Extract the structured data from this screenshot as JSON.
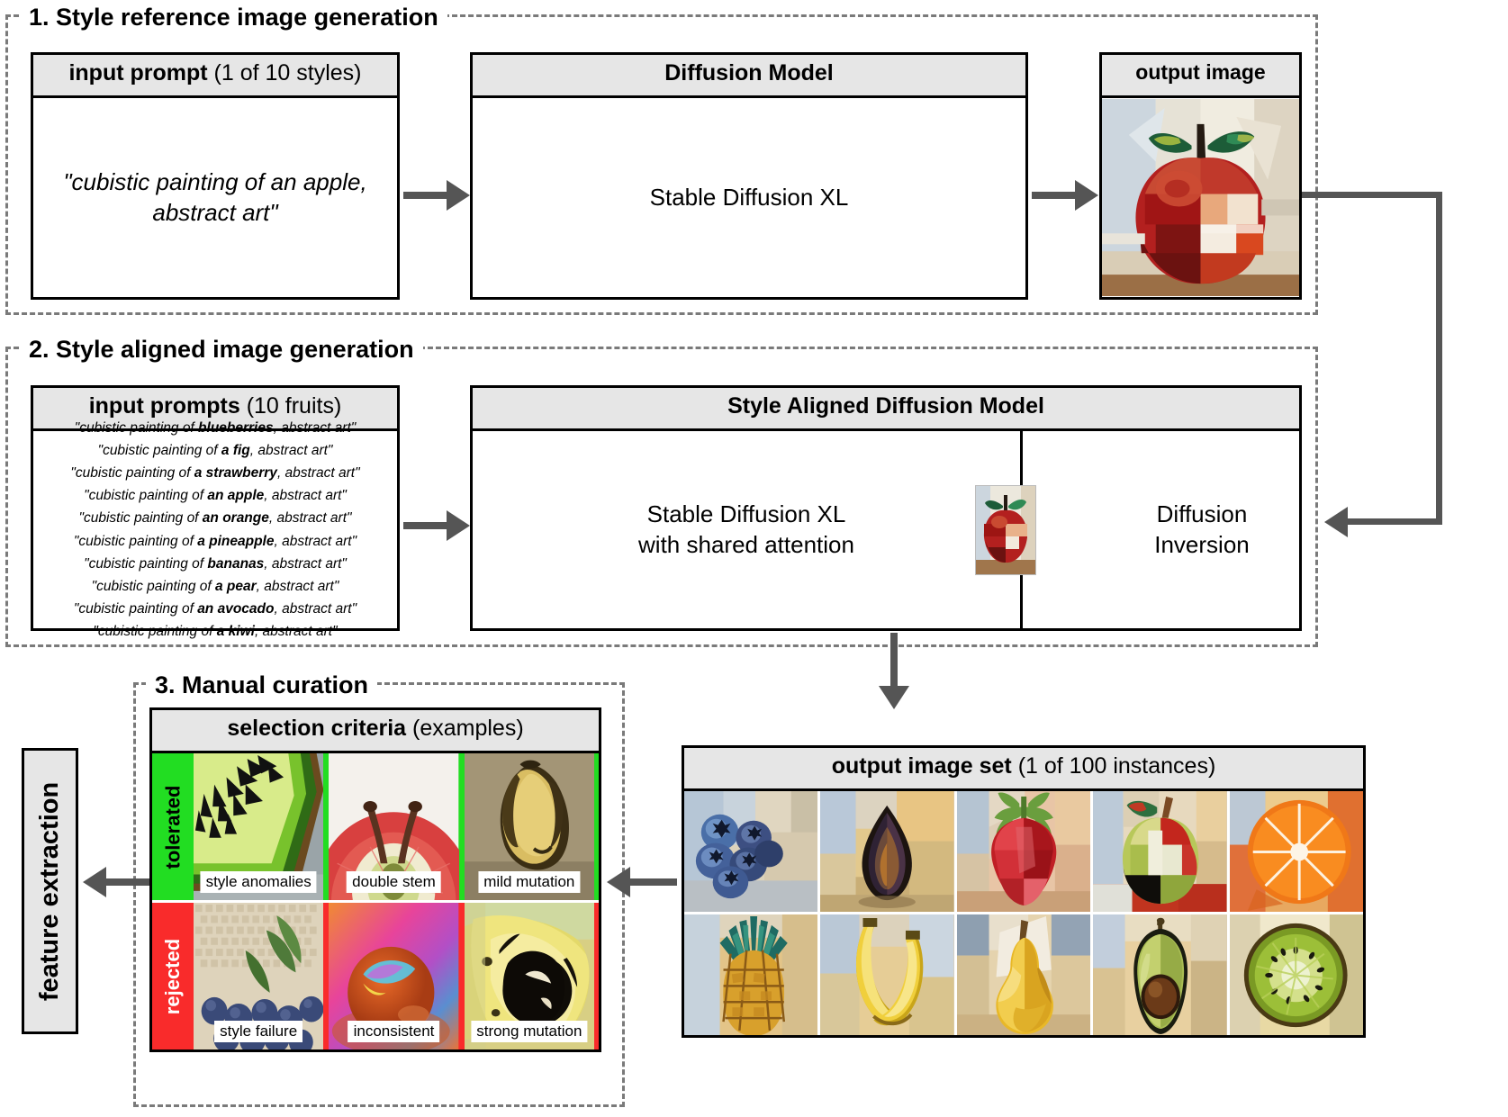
{
  "stages": {
    "stage1": {
      "title": "1. Style reference image generation"
    },
    "stage2": {
      "title": "2. Style aligned image generation"
    },
    "stage3": {
      "title": "3. Manual curation"
    }
  },
  "stage1": {
    "input_box": {
      "header_bold": "input prompt",
      "header_rest": " (1 of 10 styles)",
      "prompt": "\"cubistic painting of an apple, abstract art\""
    },
    "model_box": {
      "header_bold": "Diffusion Model",
      "body": "Stable Diffusion XL"
    },
    "output_box": {
      "header_bold": "output image",
      "image_alt": "cubistic-apple-painting"
    }
  },
  "stage2": {
    "input_box": {
      "header_bold": "input prompts",
      "header_rest": " (10 fruits)",
      "prompts": [
        {
          "prefix": "\"cubistic painting of ",
          "fruit": "blueberries",
          "suffix": ", abstract art\""
        },
        {
          "prefix": "\"cubistic painting of ",
          "fruit": "a fig",
          "suffix": ", abstract art\""
        },
        {
          "prefix": "\"cubistic painting of ",
          "fruit": "a strawberry",
          "suffix": ", abstract art\""
        },
        {
          "prefix": "\"cubistic painting of ",
          "fruit": "an apple",
          "suffix": ", abstract art\""
        },
        {
          "prefix": "\"cubistic painting of ",
          "fruit": "an orange",
          "suffix": ", abstract art\""
        },
        {
          "prefix": "\"cubistic painting of ",
          "fruit": "a pineapple",
          "suffix": ", abstract art\""
        },
        {
          "prefix": "\"cubistic painting of ",
          "fruit": "bananas",
          "suffix": ", abstract art\""
        },
        {
          "prefix": "\"cubistic painting of ",
          "fruit": "a pear",
          "suffix": ", abstract art\""
        },
        {
          "prefix": "\"cubistic painting of ",
          "fruit": "an avocado",
          "suffix": ", abstract art\""
        },
        {
          "prefix": "\"cubistic painting of ",
          "fruit": "a kiwi",
          "suffix": ", abstract art\""
        }
      ]
    },
    "model_box": {
      "header_bold": "Style Aligned Diffusion Model",
      "left_line1": "Stable Diffusion XL",
      "left_line2": "with shared attention",
      "right_line1": "Diffusion",
      "right_line2": "Inversion",
      "thumb_alt": "cubistic-apple-thumbnail"
    }
  },
  "stage3": {
    "criteria_box": {
      "header_bold": "selection criteria",
      "header_rest": " (examples)",
      "tolerated_label": "tolerated",
      "rejected_label": "rejected",
      "tolerated_color": "#22dd22",
      "rejected_color": "#f92b2b",
      "tolerated": [
        {
          "caption": "style anomalies",
          "subject": "kiwi-slice-pixelated"
        },
        {
          "caption": "double stem",
          "subject": "apple-double-stem"
        },
        {
          "caption": "mild mutation",
          "subject": "bananas-mild-mutation"
        }
      ],
      "rejected": [
        {
          "caption": "style failure",
          "subject": "blueberries-photo-style"
        },
        {
          "caption": "inconsistent",
          "subject": "orange-iridescent"
        },
        {
          "caption": "strong mutation",
          "subject": "bananas-strong-mutation"
        }
      ]
    },
    "feature_extraction": {
      "label": "feature extraction"
    }
  },
  "output_set": {
    "header_bold": "output image set",
    "header_rest": " (1 of 100 instances)",
    "items": [
      {
        "name": "blueberries"
      },
      {
        "name": "fig"
      },
      {
        "name": "strawberry"
      },
      {
        "name": "apple"
      },
      {
        "name": "orange"
      },
      {
        "name": "pineapple"
      },
      {
        "name": "bananas"
      },
      {
        "name": "pear"
      },
      {
        "name": "avocado"
      },
      {
        "name": "kiwi"
      }
    ]
  },
  "colors": {
    "arrow": "#555555",
    "header_fill": "#e6e6e6",
    "dashed_border": "#7a7a7a",
    "box_border": "#000000"
  }
}
